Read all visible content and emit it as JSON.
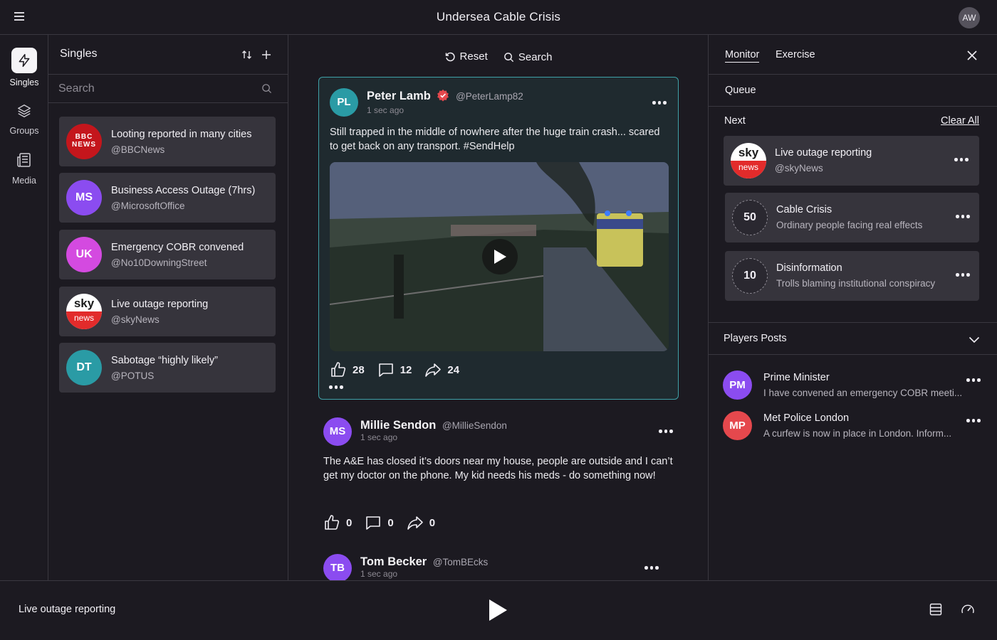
{
  "header": {
    "title": "Undersea Cable Crisis",
    "user_initials": "AW"
  },
  "rail": [
    {
      "label": "Singles",
      "icon": "lightning-icon",
      "active": true
    },
    {
      "label": "Groups",
      "icon": "layers-icon",
      "active": false
    },
    {
      "label": "Media",
      "icon": "newspaper-icon",
      "active": false
    }
  ],
  "singles": {
    "title": "Singles",
    "search_placeholder": "Search",
    "items": [
      {
        "title": "Looting reported in many cities",
        "handle": "@BBCNews",
        "avatar": "BBC NEWS",
        "color": "#c4161c"
      },
      {
        "title": "Business Access Outage (7hrs)",
        "handle": "@MicrosoftOffice",
        "avatar": "MS",
        "color": "#8b4cf0"
      },
      {
        "title": "Emergency COBR convened",
        "handle": "@No10DowningStreet",
        "avatar": "UK",
        "color": "#d44ae0"
      },
      {
        "title": "Live outage reporting",
        "handle": "@skyNews",
        "avatar": "sky news",
        "color": "#ffffff"
      },
      {
        "title": "Sabotage “highly likely”",
        "handle": "@POTUS",
        "avatar": "DT",
        "color": "#2a9ba5"
      }
    ]
  },
  "feed": {
    "reset_label": "Reset",
    "search_label": "Search",
    "posts": [
      {
        "initials": "PL",
        "name": "Peter Lamb",
        "handle": "@PeterLamp82",
        "time": "1 sec ago",
        "text": "Still trapped in the middle of nowhere after the huge train crash... scared to get back on any transport. #SendHelp",
        "likes": "28",
        "comments": "12",
        "shares": "24",
        "color": "#2a9ba5",
        "verified": true
      },
      {
        "initials": "MS",
        "name": "Millie Sendon",
        "handle": "@MillieSendon",
        "time": "1 sec ago",
        "text": "The A&E has closed it’s doors near my house, people are outside and I can’t get my doctor on the phone. My kid needs his meds - do something now!",
        "likes": "0",
        "comments": "0",
        "shares": "0",
        "color": "#8b4cf0"
      },
      {
        "initials": "TB",
        "name": "Tom Becker",
        "handle": "@TomBEcks",
        "time": "1 sec ago",
        "color": "#8b4cf0"
      }
    ]
  },
  "right": {
    "tabs": [
      "Monitor",
      "Exercise"
    ],
    "queue_label": "Queue",
    "next_label": "Next",
    "clear_all_label": "Clear All",
    "next_items": [
      {
        "avatar": "sky news",
        "title": "Live outage reporting",
        "subtitle": "@skyNews"
      },
      {
        "number": "50",
        "title": "Cable Crisis",
        "subtitle": "Ordinary people facing real effects"
      },
      {
        "number": "10",
        "title": "Disinformation",
        "subtitle": "Trolls blaming institutional conspiracy"
      }
    ],
    "players_label": "Players Posts",
    "players": [
      {
        "initials": "PM",
        "name": "Prime Minister",
        "text": "I have convened an emergency COBR meeti...",
        "color": "#8b4cf0"
      },
      {
        "initials": "MP",
        "name": "Met Police London",
        "text": "A curfew is now in place in London. Inform...",
        "color": "#e5484d"
      }
    ]
  },
  "bottom": {
    "now_playing": "Live outage reporting"
  }
}
